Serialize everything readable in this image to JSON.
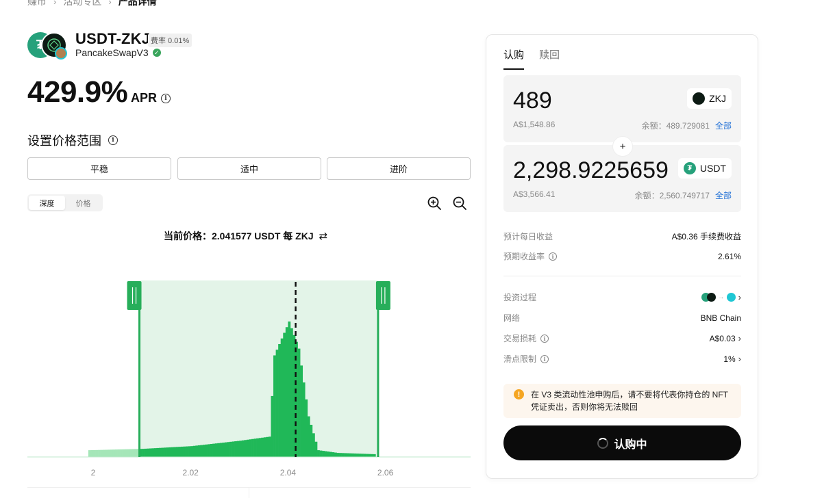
{
  "breadcrumb": [
    "赚币",
    "活动专区",
    "产品详情"
  ],
  "product": {
    "pair": "USDT-ZKJ",
    "fee_label": "费率 0.01%",
    "protocol": "PancakeSwapV3",
    "apr_value": "429.9%",
    "apr_label": "APR"
  },
  "range": {
    "title": "设置价格范围",
    "strategies": [
      "平稳",
      "适中",
      "进阶"
    ],
    "view_modes": [
      "深度",
      "价格"
    ],
    "active_view": "深度",
    "current_price_label": "当前价格：",
    "current_price_value": "2.041577 USDT 每 ZKJ"
  },
  "chart_data": {
    "type": "area",
    "x_ticks": [
      "2",
      "2.02",
      "2.04",
      "2.06"
    ],
    "selected_range": [
      2.0095,
      2.0585
    ],
    "current_price": 2.041577,
    "liquidity_profile": [
      {
        "x": 1.999,
        "y": 5
      },
      {
        "x": 2.01,
        "y": 6
      },
      {
        "x": 2.02,
        "y": 8
      },
      {
        "x": 2.03,
        "y": 12
      },
      {
        "x": 2.036,
        "y": 15
      },
      {
        "x": 2.037,
        "y": 75
      },
      {
        "x": 2.04,
        "y": 100
      },
      {
        "x": 2.042,
        "y": 80
      },
      {
        "x": 2.044,
        "y": 30
      },
      {
        "x": 2.046,
        "y": 5
      },
      {
        "x": 2.05,
        "y": 3
      },
      {
        "x": 2.058,
        "y": 2
      }
    ],
    "colors": {
      "range_fill": "#e3f4e8",
      "bars": "#20b858",
      "outside_bars": "#a5e6b8",
      "handles": "#27ae5a"
    }
  },
  "panel": {
    "tabs": [
      "认购",
      "赎回"
    ],
    "active_tab": "认购",
    "inputs": [
      {
        "amount": "489",
        "fiat": "A$1,548.86",
        "token": "ZKJ",
        "balance_label": "余额：",
        "balance": "489.729081",
        "max_label": "全部"
      },
      {
        "amount": "2,298.9225659",
        "fiat": "A$3,566.41",
        "token": "USDT",
        "balance_label": "余额：",
        "balance": "2,560.749717",
        "max_label": "全部"
      }
    ],
    "plus_symbol": "+",
    "daily_earnings_label": "预计每日收益",
    "daily_earnings_value": "A$0.36 手续费收益",
    "expected_apr_label": "预期收益率",
    "expected_apr_value": "2.61%",
    "process_label": "投资过程",
    "network_label": "网络",
    "network_value": "BNB Chain",
    "tx_cost_label": "交易损耗",
    "tx_cost_value": "A$0.03",
    "slippage_label": "滑点限制",
    "slippage_value": "1%",
    "warning": "在 V3 类流动性池申购后，请不要将代表你持仓的 NFT 凭证卖出，否则你将无法赎回",
    "submit_label": "认购中"
  },
  "colors": {
    "accent": "#20b858",
    "link": "#1f6fd6",
    "warning": "#f5a623",
    "button": "#0b0b0b"
  }
}
